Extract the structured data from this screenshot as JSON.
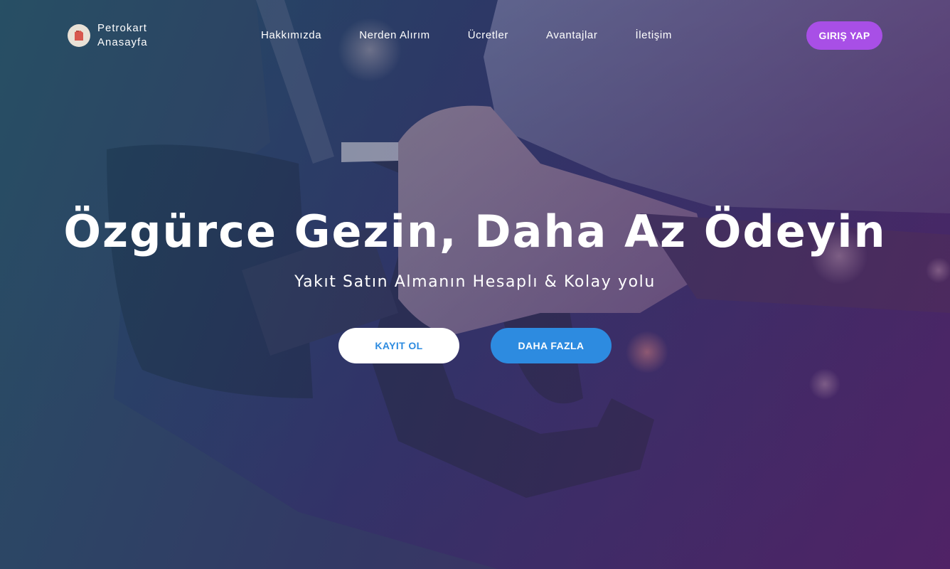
{
  "brand": {
    "line1": "Petrokart",
    "line2": "Anasayfa",
    "logo_icon": "fuel-can-icon"
  },
  "nav": {
    "items": [
      {
        "label": "Hakkımızda"
      },
      {
        "label": "Nerden Alırım"
      },
      {
        "label": "Ücretler"
      },
      {
        "label": "Avantajlar"
      },
      {
        "label": "İletişim"
      }
    ],
    "login_label": "GIRIŞ YAP"
  },
  "hero": {
    "title": "Özgürce Gezin, Daha Az Ödeyin",
    "subtitle": "Yakıt Satın Almanın Hesaplı & Kolay yolu",
    "register_label": "KAYIT OL",
    "more_label": "DAHA FAZLA"
  },
  "colors": {
    "login_button": "#a84fe6",
    "primary_blue": "#2d8be0",
    "white": "#ffffff"
  }
}
